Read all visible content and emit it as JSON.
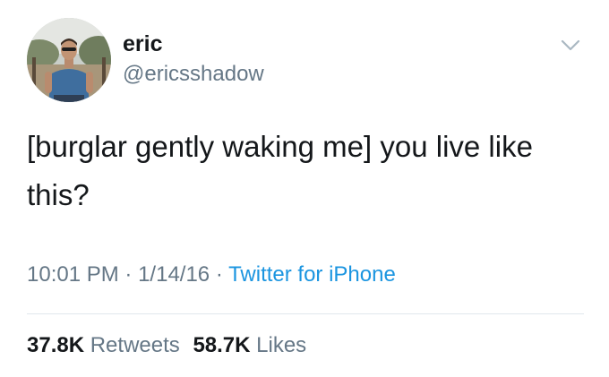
{
  "user": {
    "display_name": "eric",
    "handle": "@ericsshadow"
  },
  "icons": {
    "menu": "chevron-down-icon"
  },
  "tweet": {
    "text": "[burglar gently waking me] you live like this?",
    "time": "10:01 PM",
    "date": "1/14/16",
    "separator": "·",
    "source": "Twitter for iPhone"
  },
  "stats": {
    "retweets_count": "37.8K",
    "retweets_label": "Retweets",
    "likes_count": "58.7K",
    "likes_label": "Likes"
  },
  "colors": {
    "text": "#14171a",
    "secondary": "#657786",
    "link": "#1b95e0",
    "divider": "#e1e8ed"
  }
}
